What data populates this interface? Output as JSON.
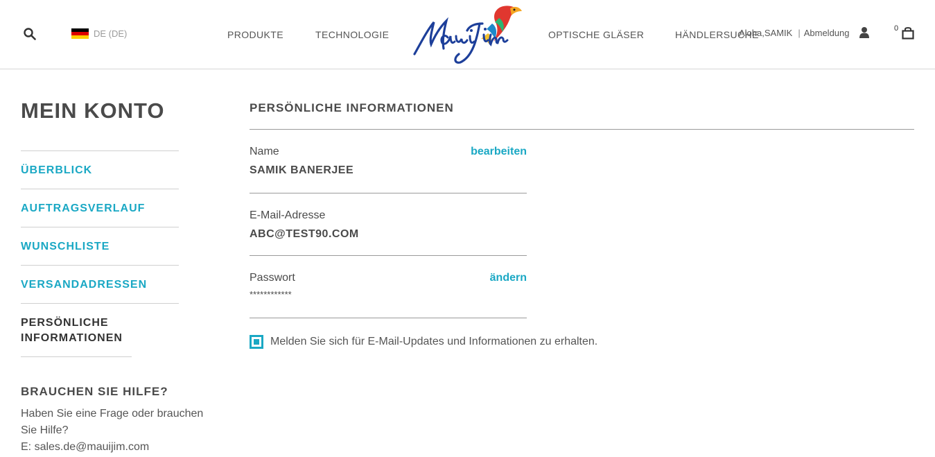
{
  "header": {
    "locale_label": "DE (DE)",
    "nav": [
      "PRODUKTE",
      "TECHNOLOGIE",
      "OPTISCHE GLÄSER",
      "HÄNDLERSUCHE"
    ],
    "greeting": "Aloha,SAMIK",
    "logout": "Abmeldung",
    "cart_count": "0",
    "logo_text": "Maui Jim"
  },
  "sidebar": {
    "title": "MEIN KONTO",
    "items": [
      {
        "label": "ÜBERBLICK"
      },
      {
        "label": "AUFTRAGSVERLAUF"
      },
      {
        "label": "WUNSCHLISTE"
      },
      {
        "label": "VERSANDADRESSEN"
      },
      {
        "label": "PERSÖNLICHE INFORMATIONEN"
      }
    ],
    "help_title": "BRAUCHEN SIE HILFE?",
    "help_text": "Haben Sie eine Frage oder brauchen Sie Hilfe?",
    "help_email": "E: sales.de@mauijim.com"
  },
  "main": {
    "title": "PERSÖNLICHE INFORMATIONEN",
    "name_label": "Name",
    "name_value": "SAMIK BANERJEE",
    "name_action": "bearbeiten",
    "email_label": "E-Mail-Adresse",
    "email_value": "ABC@TEST90.COM",
    "password_label": "Passwort",
    "password_value": "************",
    "password_action": "ändern",
    "optin_label": "Melden Sie sich für E-Mail-Updates und Informationen zu erhalten.",
    "optin_checked": true
  },
  "colors": {
    "accent": "#1aa8c4",
    "text": "#4a4a4a",
    "logo_blue": "#1d3f9a"
  }
}
